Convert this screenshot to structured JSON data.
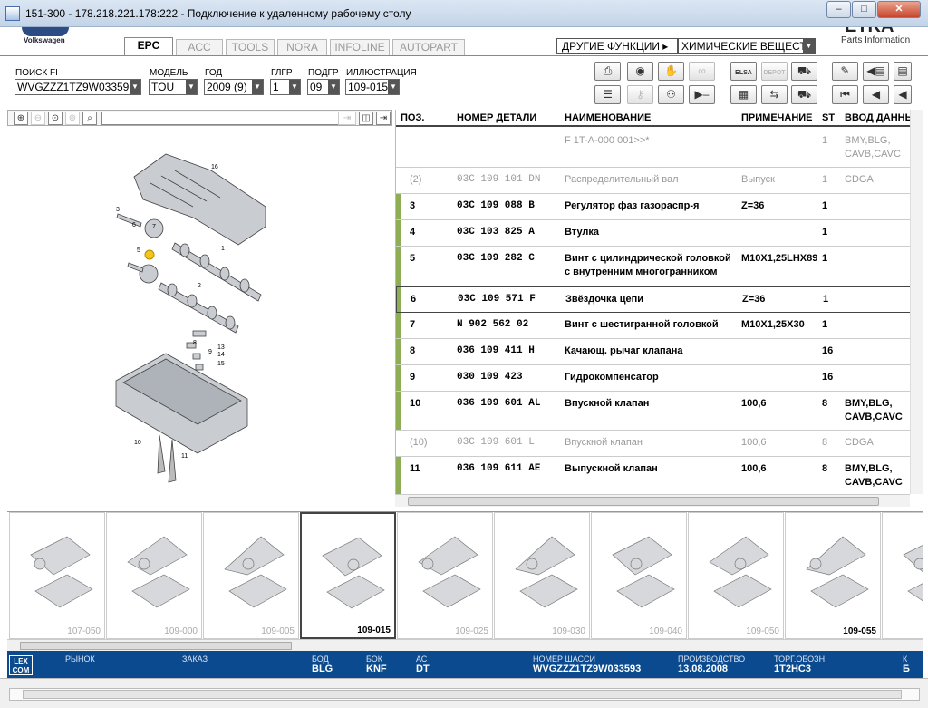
{
  "window": {
    "title": "151-300 - 178.218.221.178:222 - Подключение к удаленному рабочему столу"
  },
  "brand": {
    "logo_text": "Volkswagen",
    "product_name": "ETKA",
    "product_sub": "Parts Information"
  },
  "tabs": [
    {
      "label": "EPC",
      "active": true
    },
    {
      "label": "ACC",
      "active": false
    },
    {
      "label": "TOOLS",
      "active": false
    },
    {
      "label": "NORA",
      "active": false
    },
    {
      "label": "INFOLINE",
      "active": false
    },
    {
      "label": "AUTOPART",
      "active": false
    }
  ],
  "other_functions": {
    "label": "ДРУГИЕ ФУНКЦИИ ▸",
    "selected": "ХИМИЧЕСКИЕ ВЕЩЕСТВА"
  },
  "filters": {
    "search_fi": {
      "label": "ПОИСК FI",
      "value": "WVGZZZ1TZ9W03359"
    },
    "model": {
      "label": "МОДЕЛЬ",
      "value": "TOU"
    },
    "year": {
      "label": "ГОД",
      "value": "2009 (9)"
    },
    "main_group": {
      "label": "ГЛГР",
      "value": "1"
    },
    "sub_group": {
      "label": "ПОДГР",
      "value": "09"
    },
    "illustration": {
      "label": "ИЛЛЮСТРАЦИЯ",
      "value": "109-015"
    }
  },
  "toolbar_labels": {
    "elsa": "ELSA",
    "depot": "DEPOT"
  },
  "table": {
    "columns": [
      "ПОЗ.",
      "НОМЕР ДЕТАЛИ",
      "НАИМЕНОВАНИЕ",
      "ПРИМЕЧАНИЕ",
      "ST",
      "ВВОД ДАННЫХ"
    ],
    "rows": [
      {
        "pos": "",
        "part": "",
        "name": "F 1T-A-000 001>>*",
        "note": "",
        "st": "1",
        "data": "BMY,BLG, CAVB,CAVC",
        "style": "g"
      },
      {
        "pos": "(2)",
        "part": "03C  109  101  DN",
        "name": "Распределительный вал",
        "note": "Выпуск",
        "st": "1",
        "data": "CDGA",
        "style": "g"
      },
      {
        "pos": "3",
        "part": "03C  109  088  B",
        "name": "Регулятор фаз газораспр-я",
        "note": "Z=36",
        "st": "1",
        "data": "",
        "style": "b"
      },
      {
        "pos": "4",
        "part": "03C  103  825  A",
        "name": "Втулка",
        "note": "",
        "st": "1",
        "data": "",
        "style": "b"
      },
      {
        "pos": "5",
        "part": "03C  109  282  C",
        "name": "Винт с цилиндрической головкой с внутренним многогранником",
        "note": "M10X1,25LHX89",
        "st": "1",
        "data": "",
        "style": "b"
      },
      {
        "pos": "6",
        "part": "03C  109  571  F",
        "name": "Звёздочка цепи",
        "note": "Z=36",
        "st": "1",
        "data": "",
        "style": "b sel"
      },
      {
        "pos": "7",
        "part": "N     902  562  02",
        "name": "Винт с шестигранной головкой",
        "note": "M10X1,25X30",
        "st": "1",
        "data": "",
        "style": "b"
      },
      {
        "pos": "8",
        "part": "036  109  411  H",
        "name": "Качающ. рычаг клапана",
        "note": "",
        "st": "16",
        "data": "",
        "style": "b"
      },
      {
        "pos": "9",
        "part": "030  109  423",
        "name": "Гидрокомпенсатор",
        "note": "",
        "st": "16",
        "data": "",
        "style": "b"
      },
      {
        "pos": "10",
        "part": "036  109  601  AL",
        "name": "Впускной клапан",
        "note": "100,6",
        "st": "8",
        "data": "BMY,BLG, CAVB,CAVC",
        "style": "b"
      },
      {
        "pos": "(10)",
        "part": "03C  109  601  L",
        "name": "Впускной клапан",
        "note": "100,6",
        "st": "8",
        "data": "CDGA",
        "style": "g"
      },
      {
        "pos": "11",
        "part": "036  109  611  AE",
        "name": "Выпускной клапан",
        "note": "100,6",
        "st": "8",
        "data": "BMY,BLG, CAVB,CAVC",
        "style": "b"
      }
    ]
  },
  "callouts": [
    "1",
    "2",
    "3",
    "5",
    "6",
    "7",
    "8",
    "9",
    "10",
    "11",
    "13",
    "14",
    "15",
    "16"
  ],
  "thumbnails": [
    {
      "label": "107-050",
      "state": ""
    },
    {
      "label": "109-000",
      "state": ""
    },
    {
      "label": "109-005",
      "state": ""
    },
    {
      "label": "109-015",
      "state": "sel"
    },
    {
      "label": "109-025",
      "state": ""
    },
    {
      "label": "109-030",
      "state": ""
    },
    {
      "label": "109-040",
      "state": ""
    },
    {
      "label": "109-050",
      "state": ""
    },
    {
      "label": "109-055",
      "state": "hl"
    },
    {
      "label": "",
      "state": ""
    }
  ],
  "status": {
    "lexcom": "LEX COM",
    "market_label": "РЫНОК",
    "market_value": "",
    "order_label": "ЗАКАЗ",
    "order_value": "",
    "engine_label": "БОД",
    "engine_value": "BLG",
    "gearbox_label": "БОК",
    "gearbox_value": "KNF",
    "ac_label": "АС",
    "ac_value": "DT",
    "chassis_label": "НОМЕР ШАССИ",
    "chassis_value": "WVGZZZ1TZ9W033593",
    "production_label": "ПРОИЗВОДСТВО",
    "production_value": "13.08.2008",
    "trade_label": "ТОРГ.ОБОЗН.",
    "trade_value": "1T2HC3",
    "last_label": "К",
    "last_value": "Б"
  },
  "colors": {
    "status_bg": "#0b4a8e",
    "row_marker": "#8fad55",
    "callout_highlight": "#f5c518"
  }
}
